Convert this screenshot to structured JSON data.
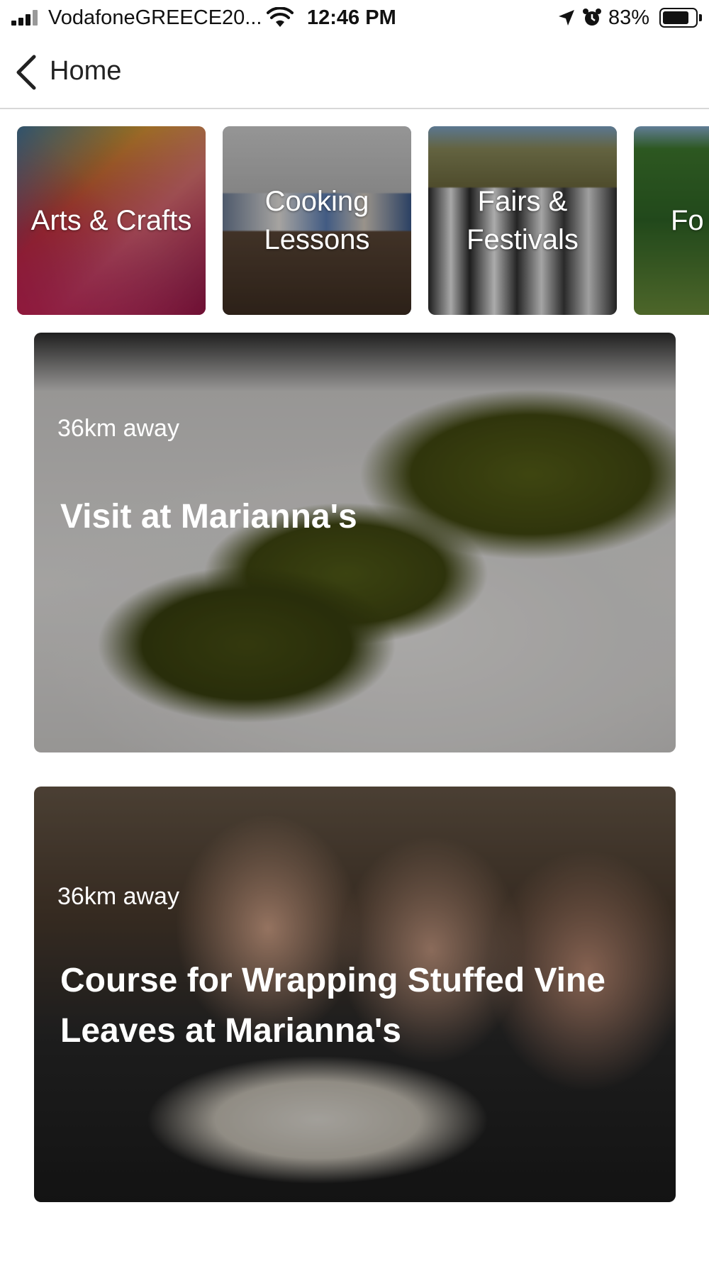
{
  "status_bar": {
    "carrier": "VodafoneGREECE20...",
    "time": "12:46 PM",
    "battery_percent": "83%",
    "battery_level": 0.83,
    "icons": [
      "signal-icon",
      "wifi-icon",
      "location-arrow-icon",
      "alarm-icon",
      "battery-icon"
    ]
  },
  "nav": {
    "back_label": "Home",
    "back_icon": "chevron-left-icon"
  },
  "categories": [
    {
      "label": "Arts & Crafts"
    },
    {
      "label": "Cooking Lessons"
    },
    {
      "label": "Fairs & Festivals"
    },
    {
      "label": "Fo"
    }
  ],
  "experiences": [
    {
      "distance": "36km away",
      "title": "Visit at Marianna's"
    },
    {
      "distance": "36km away",
      "title": "Course for Wrapping Stuffed Vine Leaves at Marianna's"
    }
  ],
  "colors": {
    "text_primary": "#111111",
    "overlay_text": "#ffffff",
    "divider": "#d8d8d8"
  }
}
